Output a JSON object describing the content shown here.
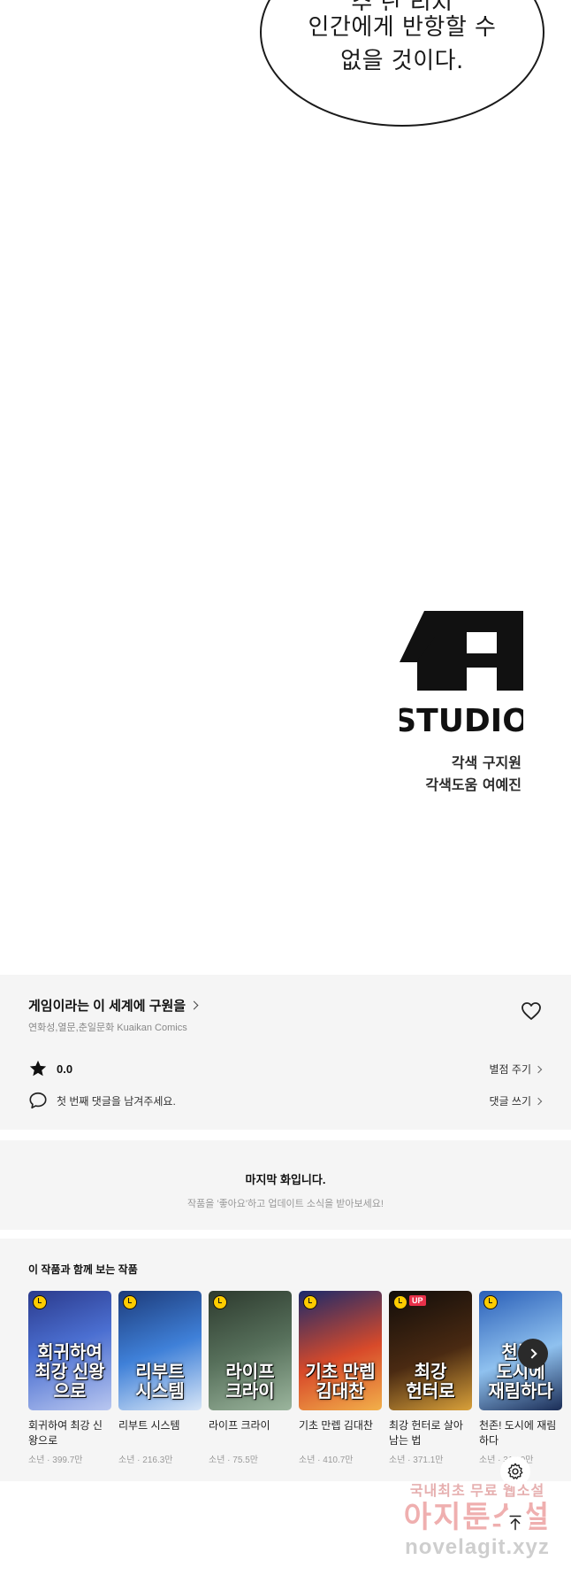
{
  "comic": {
    "bubble_line1": "수 난 리지",
    "bubble_line2": "인간에게 반항할 수",
    "bubble_line3": "없을 것이다.",
    "studio_logo_text": "STUDIO",
    "credit_1": "각색 구지원",
    "credit_2": "각색도움 여예진"
  },
  "info": {
    "title": "게임이라는 이 세계에 구원을",
    "meta": "연화성,열문,춘일문화 Kuaikan Comics",
    "rating": "0.0",
    "rate_link": "별점 주기",
    "comment_placeholder": "첫 번째 댓글을 남겨주세요.",
    "comment_link": "댓글 쓰기"
  },
  "last_episode": {
    "title": "마지막 화입니다.",
    "subtitle": "작품을 '좋아요'하고 업데이트 소식을 받아보세요!"
  },
  "recommendations": {
    "heading": "이 작품과 함께 보는 작품",
    "items": [
      {
        "cover_title": "회귀하여\n최강 신왕으로",
        "name": "회귀하여 최강 신왕으로",
        "meta": "소년 · 399.7만",
        "up": "",
        "bg": "linear-gradient(160deg,#2b3a8c 0%,#4b6fd1 45%,#b9c7f0 100%)"
      },
      {
        "cover_title": "리부트\n시스템",
        "name": "리부트 시스템",
        "meta": "소년 · 216.3만",
        "up": "",
        "bg": "linear-gradient(160deg,#1d3b7a 0%,#3f80d8 50%,#d8e6f7 100%)"
      },
      {
        "cover_title": "라이프\n크라이",
        "name": "라이프 크라이",
        "meta": "소년 · 75.5만",
        "up": "",
        "bg": "linear-gradient(160deg,#2d3a2e 0%,#57705b 50%,#9bb59d 100%)"
      },
      {
        "cover_title": "기초 만렙\n김대찬",
        "name": "기초 만렙 김대찬",
        "meta": "소년 · 410.7만",
        "up": "",
        "bg": "linear-gradient(160deg,#1b2a6b 0%,#d84a2a 55%,#f2b04a 100%)"
      },
      {
        "cover_title": "최강\n헌터로",
        "name": "최강 헌터로 살아남는 법",
        "meta": "소년 · 371.1만",
        "up": "UP",
        "bg": "linear-gradient(160deg,#120d0a 0%,#4a2a12 55%,#d9a13a 100%)"
      },
      {
        "cover_title": "천존!\n도시에\n재림하다",
        "name": "천존! 도시에 재림하다",
        "meta": "소년 · 312.9만",
        "up": "",
        "bg": "linear-gradient(160deg,#2a5fb8 0%,#8fc1ef 55%,#1a2c55 100%)"
      }
    ]
  },
  "watermark": {
    "line1": "국내최초 무료 웹소설",
    "line2": "아지툰소설",
    "line3": "novelagit.xyz"
  }
}
